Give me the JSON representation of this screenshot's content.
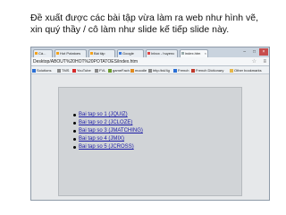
{
  "caption": "Đề xuất được các bài tập vừa làm ra web như hình vẽ, xin quý thầy / cô làm như slide kế tiếp slide này.",
  "browser": {
    "tabs": [
      {
        "label": "Cá...",
        "active": false
      },
      {
        "label": "Hot Potatoes",
        "active": false
      },
      {
        "label": "Bài tập",
        "active": false
      },
      {
        "label": "Google",
        "active": false
      },
      {
        "label": "Inbox - huyenc",
        "active": false
      },
      {
        "label": "index.htm",
        "active": true
      }
    ],
    "window_controls": {
      "minimize": "–",
      "maximize": "□",
      "close": "×"
    },
    "address": "Desktop/ABOUT%20HOT%20POTATOES/index.htm",
    "bookmarks": [
      {
        "label": "Solutions",
        "icon": "ms-icon",
        "color": "#2a6fd6"
      },
      {
        "label": "TMS",
        "icon": "page-icon",
        "color": "#888888"
      },
      {
        "label": "YouTube",
        "icon": "youtube-icon",
        "color": "#d62a2a"
      },
      {
        "label": "FVL",
        "icon": "page-icon",
        "color": "#888888"
      },
      {
        "label": "gameFach",
        "icon": "page-icon",
        "color": "#6a9b2f"
      },
      {
        "label": "moodle",
        "icon": "page-icon",
        "color": "#e08a1e"
      },
      {
        "label": "http:/bd/4g",
        "icon": "page-icon",
        "color": "#888888"
      },
      {
        "label": "French",
        "icon": "page-icon",
        "color": "#2a6fd6"
      },
      {
        "label": "French Dictionary",
        "icon": "page-icon",
        "color": "#c0392b"
      },
      {
        "label": "Other bookmarks",
        "icon": "folder-icon",
        "color": "#e6b84a"
      }
    ]
  },
  "content": {
    "links": [
      "Bai tap so 1 (JQUIZ)",
      "Bai tap so 2 (JCLOZE)",
      "Bai tap so 3 (JMATCHING)",
      "Bai tap so 4 (JMIX)",
      "Bai tap so 5 (JCROSS)"
    ]
  }
}
